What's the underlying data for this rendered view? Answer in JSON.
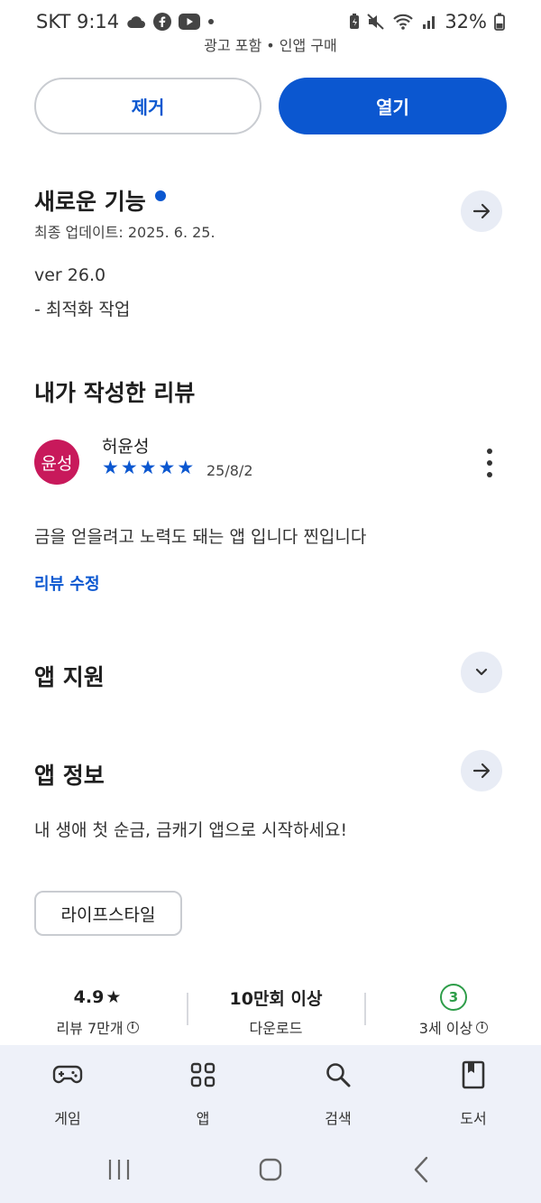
{
  "status_bar": {
    "carrier_time": "SKT 9:14",
    "battery": "32%",
    "icons_left": [
      "cloud-icon",
      "facebook-icon",
      "youtube-icon",
      "dot-icon"
    ],
    "icons_right": [
      "battery-saver-icon",
      "mute-icon",
      "wifi-icon",
      "signal-icon",
      "battery-icon"
    ]
  },
  "ad_notice": "광고 포함  •  인앱 구매",
  "actions": {
    "remove": "제거",
    "open": "열기"
  },
  "whats_new": {
    "title": "새로운 기능",
    "updated": "최종 업데이트: 2025. 6. 25.",
    "version": "ver 26.0",
    "note": "- 최적화 작업"
  },
  "my_review": {
    "title": "내가 작성한 리뷰",
    "avatar_text": "윤성",
    "avatar_color": "#c8195b",
    "author": "허윤성",
    "rating": 5,
    "date": "25/8/2",
    "body": "금을 얻을려고 노력도 돼는 앱 입니다 찐입니다",
    "edit_label": "리뷰 수정"
  },
  "app_support": {
    "title": "앱 지원"
  },
  "app_info": {
    "title": "앱 정보",
    "description": "내 생애 첫 순금, 금캐기 앱으로 시작하세요!",
    "category": "라이프스타일"
  },
  "stats": {
    "rating_value": "4.9",
    "rating_label": "리뷰 7만개",
    "downloads_value": "10만회 이상",
    "downloads_label": "다운로드",
    "age_badge": "3",
    "age_label": "3세 이상"
  },
  "bottom_nav": {
    "games": "게임",
    "apps": "앱",
    "search": "검색",
    "books": "도서"
  },
  "colors": {
    "accent": "#0b57d0",
    "age_green": "#2e9d49",
    "nav_bg": "#eef1f9"
  }
}
